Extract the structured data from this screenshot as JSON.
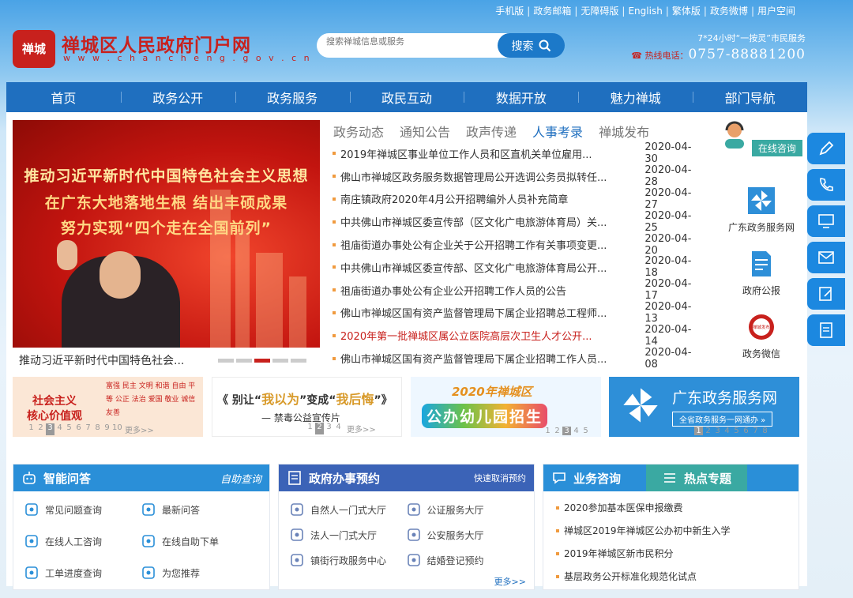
{
  "topbar": [
    "手机版",
    "政务邮箱",
    "无障碍版",
    "English",
    "繁体版",
    "政务微博",
    "用户空间"
  ],
  "logo": {
    "seal_text": "禅城",
    "title": "禅城区人民政府门户网",
    "url": "w w w . c h a n c h e n g . g o v . c n"
  },
  "search": {
    "placeholder": "搜索禅城信息或服务",
    "button": "搜索"
  },
  "hotline": {
    "line1": "7*24小时“一按灵”市民服务",
    "label": "热线电话：",
    "number": "0757-88881200"
  },
  "nav": [
    "首页",
    "政务公开",
    "政务服务",
    "政民互动",
    "数据开放",
    "魅力禅城",
    "部门导航"
  ],
  "carousel": {
    "headline1": "推动习近平新时代中国特色社会主义思想",
    "headline2": "在广东大地落地生根 结出丰硕成果",
    "headline3": "努力实现“四个走在全国前列”",
    "caption": "推动习近平新时代中国特色社会...",
    "active_slide": 3,
    "slide_count": 5
  },
  "news_tabs": [
    "政务动态",
    "通知公告",
    "政声传递",
    "人事考录",
    "禅城发布"
  ],
  "news_active_tab": "人事考录",
  "news": [
    {
      "title": "2019年禅城区事业单位工作人员和区直机关单位雇用...",
      "date": "2020-04-30"
    },
    {
      "title": "佛山市禅城区政务服务数据管理局公开选调公务员拟转任...",
      "date": "2020-04-28"
    },
    {
      "title": "南庄镇政府2020年4月公开招聘编外人员补充简章",
      "date": "2020-04-27"
    },
    {
      "title": "中共佛山市禅城区委宣传部（区文化广电旅游体育局）关...",
      "date": "2020-04-25"
    },
    {
      "title": "祖庙街道办事处公有企业关于公开招聘工作有关事项变更...",
      "date": "2020-04-20"
    },
    {
      "title": "中共佛山市禅城区委宣传部、区文化广电旅游体育局公开...",
      "date": "2020-04-18"
    },
    {
      "title": "祖庙街道办事处公有企业公开招聘工作人员的公告",
      "date": "2020-04-17"
    },
    {
      "title": "佛山市禅城区国有资产监督管理局下属企业招聘总工程师...",
      "date": "2020-04-13"
    },
    {
      "title": "2020年第一批禅城区属公立医院高层次卫生人才公开...",
      "date": "2020-04-14"
    },
    {
      "title": "佛山市禅城区国有资产监督管理局下属企业招聘工作人员...",
      "date": "2020-04-08"
    }
  ],
  "side_services": {
    "consult_btn": "在线咨询",
    "s1": "广东政务服务网",
    "s2": "政府公报",
    "s3": "政务微信",
    "wechat_seal": "禅城发布"
  },
  "banners": {
    "b1": {
      "line1": "社会主义",
      "line2": "核心价值观",
      "words": "富强 民主 文明 和谐 自由 平等 公正 法治 爱国 敬业 诚信 友善",
      "pages": [
        "1",
        "2",
        "3",
        "4",
        "5",
        "6",
        "7",
        "8",
        "9",
        "10"
      ],
      "active": "3",
      "more": "更多>>"
    },
    "b2": {
      "title_pre": "《 别让“",
      "q1": "我以为",
      "mid": "”变成“",
      "q2": "我后悔",
      "title_post": "”》",
      "sub": "— 禁毒公益宣传片",
      "pages": [
        "1",
        "2",
        "3",
        "4"
      ],
      "active": "2",
      "more": "更多>>"
    },
    "b3": {
      "title": "2020年禅城区",
      "sub": "公办幼儿园招生",
      "pages": [
        "1",
        "2",
        "3",
        "4",
        "5"
      ],
      "active": "3"
    },
    "b4": {
      "title": "广东政务服务网",
      "sub": "全省政务服务一网通办 »",
      "pages": [
        "1",
        "2",
        "3",
        "4",
        "5",
        "6",
        "7",
        "8"
      ],
      "active": "1"
    }
  },
  "cards": {
    "c1": {
      "title": "智能问答",
      "sub": "自助查询",
      "items": [
        "常见问题查询",
        "最新问答",
        "在线人工咨询",
        "在线自助下单",
        "工单进度查询",
        "为您推荐"
      ]
    },
    "c2": {
      "title": "政府办事预约",
      "link": "快速取消预约",
      "items": [
        "自然人一门式大厅",
        "公证服务大厅",
        "法人一门式大厅",
        "公安服务大厅",
        "镇街行政服务中心",
        "结婚登记预约"
      ],
      "more": "更多>>"
    },
    "c3": {
      "tab1": "业务咨询",
      "tab2": "热点专题",
      "items": [
        "2020参加基本医保申报缴费",
        "禅城区2019年禅城区公办初中新生入学",
        "2019年禅城区新市民积分",
        "基层政务公开标准化规范化试点"
      ]
    }
  }
}
